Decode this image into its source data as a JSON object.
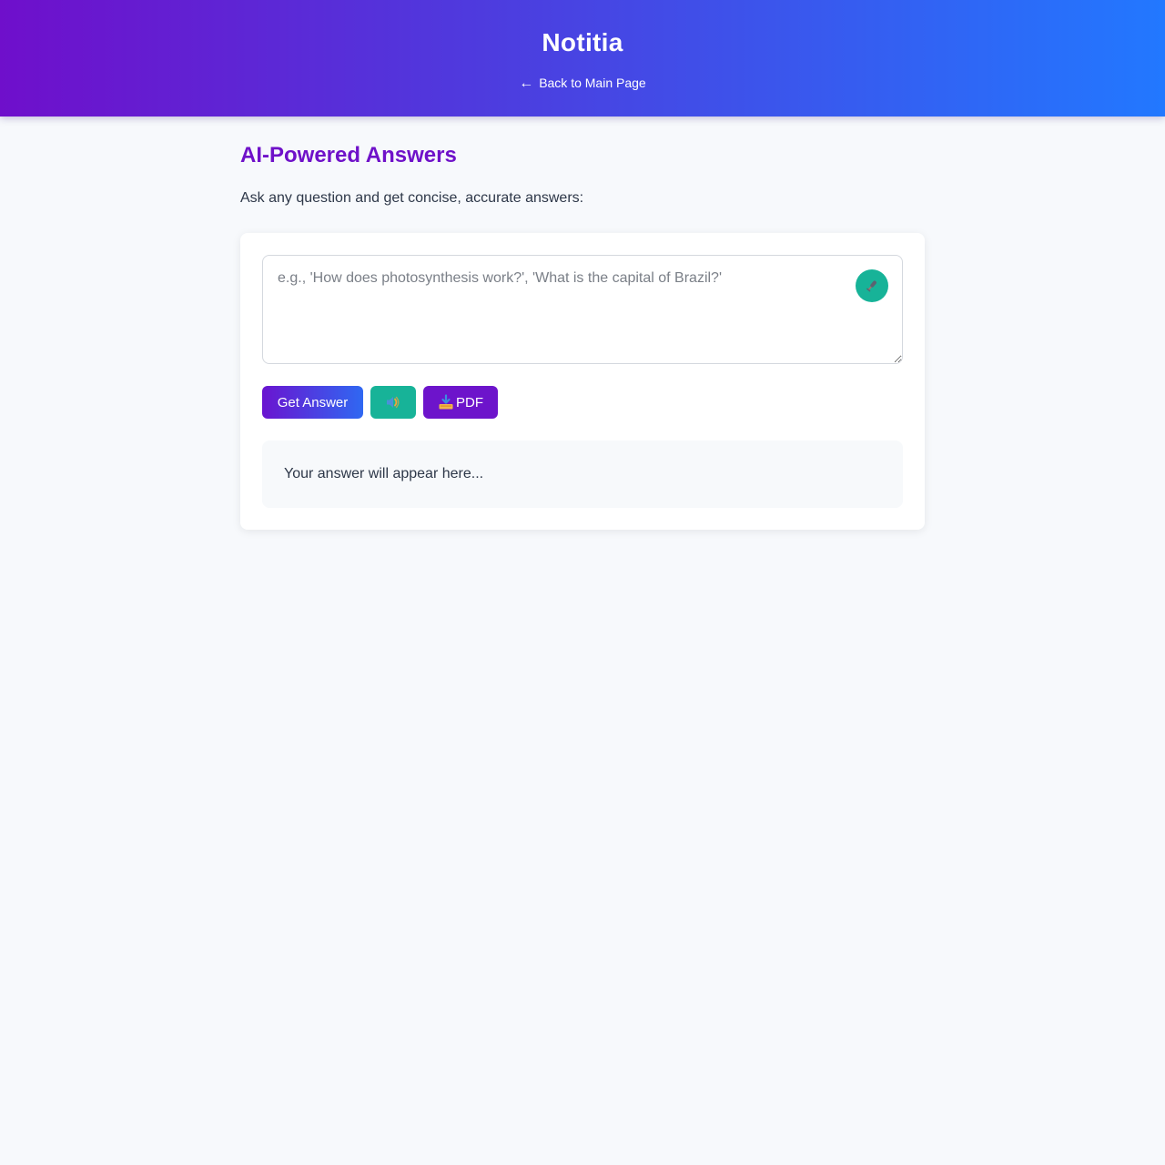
{
  "header": {
    "title": "Notitia",
    "back_arrow": "←",
    "back_label": "Back to Main Page"
  },
  "main": {
    "title": "AI-Powered Answers",
    "subtitle": "Ask any question and get concise, accurate answers:"
  },
  "question": {
    "value": "",
    "placeholder": "e.g., 'How does photosynthesis work?', 'What is the capital of Brazil?'",
    "mic_icon": "microphone-icon"
  },
  "actions": {
    "get_answer_label": "Get Answer",
    "speak_icon": "speaker-icon",
    "pdf_icon": "download-tray-icon",
    "pdf_label": "PDF"
  },
  "answer": {
    "placeholder_text": "Your answer will appear here..."
  },
  "colors": {
    "brand_purple": "#6f11c9",
    "brand_blue": "#2278ff",
    "accent_teal": "#17b398",
    "page_bg": "#f7f9fc"
  }
}
